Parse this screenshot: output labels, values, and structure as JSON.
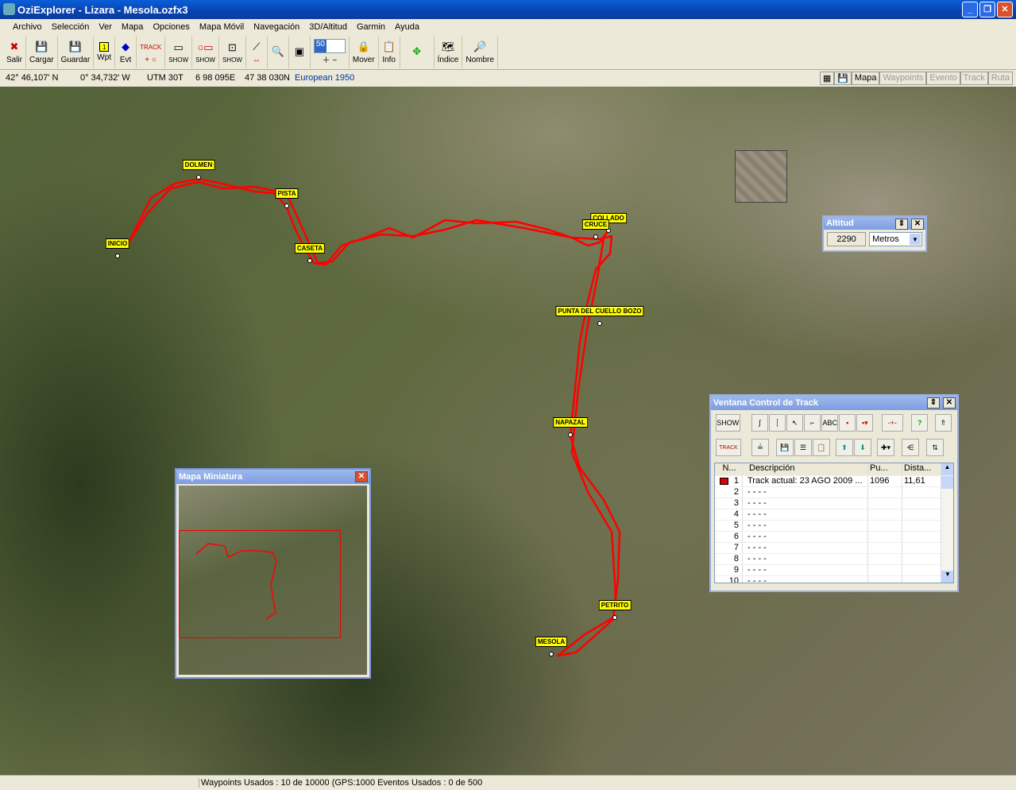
{
  "window": {
    "title": "OziExplorer - Lizara - Mesola.ozfx3",
    "controls": [
      "_",
      "❐",
      "✕"
    ]
  },
  "menu": [
    "Archivo",
    "Selección",
    "Ver",
    "Mapa",
    "Opciones",
    "Mapa Móvil",
    "Navegación",
    "3D/Altitud",
    "Garmin",
    "Ayuda"
  ],
  "toolbar": {
    "salir": "Salir",
    "cargar": "Cargar",
    "guardar": "Guardar",
    "wpt": "Wpt",
    "evt": "Evt",
    "track": "TRACK",
    "show": "SHOW",
    "zoom": "50",
    "mover": "Mover",
    "info": "Info",
    "indice": "Índice",
    "nombre": "Nombre"
  },
  "coords": {
    "lat": "42° 46,107' N",
    "lon": "0° 34,732' W",
    "utm": "UTM  30T",
    "east": "6 98 095E",
    "north": "47 38 030N",
    "datum": "European 1950"
  },
  "view_tabs": [
    "Mapa",
    "Waypoints",
    "Evento",
    "Track",
    "Ruta"
  ],
  "waypoints": [
    "INICIO",
    "DOLMEN",
    "PISTA",
    "CASETA",
    "COLLADO",
    "CRUCE",
    "PUNTA DEL CUELLO BOZO",
    "NAPAZAL",
    "PETRITO",
    "MESOLA"
  ],
  "track_color": "#ff0000",
  "altitud": {
    "title": "Altitud",
    "value": "2290",
    "unit": "Metros"
  },
  "minimap": {
    "title": "Mapa Miniatura"
  },
  "track_window": {
    "title": "Ventana Control de Track",
    "columns": [
      "N...",
      "Descripción",
      "Pu...",
      "Dista..."
    ],
    "rows": [
      {
        "n": "1",
        "desc": "Track actual: 23 AGO 2009 ...",
        "pu": "1096",
        "dist": "11,61",
        "color": "#e00000"
      },
      {
        "n": "2",
        "desc": "- - - -"
      },
      {
        "n": "3",
        "desc": "- - - -"
      },
      {
        "n": "4",
        "desc": "- - - -"
      },
      {
        "n": "5",
        "desc": "- - - -"
      },
      {
        "n": "6",
        "desc": "- - - -"
      },
      {
        "n": "7",
        "desc": "- - - -"
      },
      {
        "n": "8",
        "desc": "- - - -"
      },
      {
        "n": "9",
        "desc": "- - - -"
      },
      {
        "n": "10",
        "desc": "- - - -"
      }
    ]
  },
  "status": "Waypoints Usados : 10 de 10000  (GPS:1000  Eventos Usados : 0 de 500"
}
